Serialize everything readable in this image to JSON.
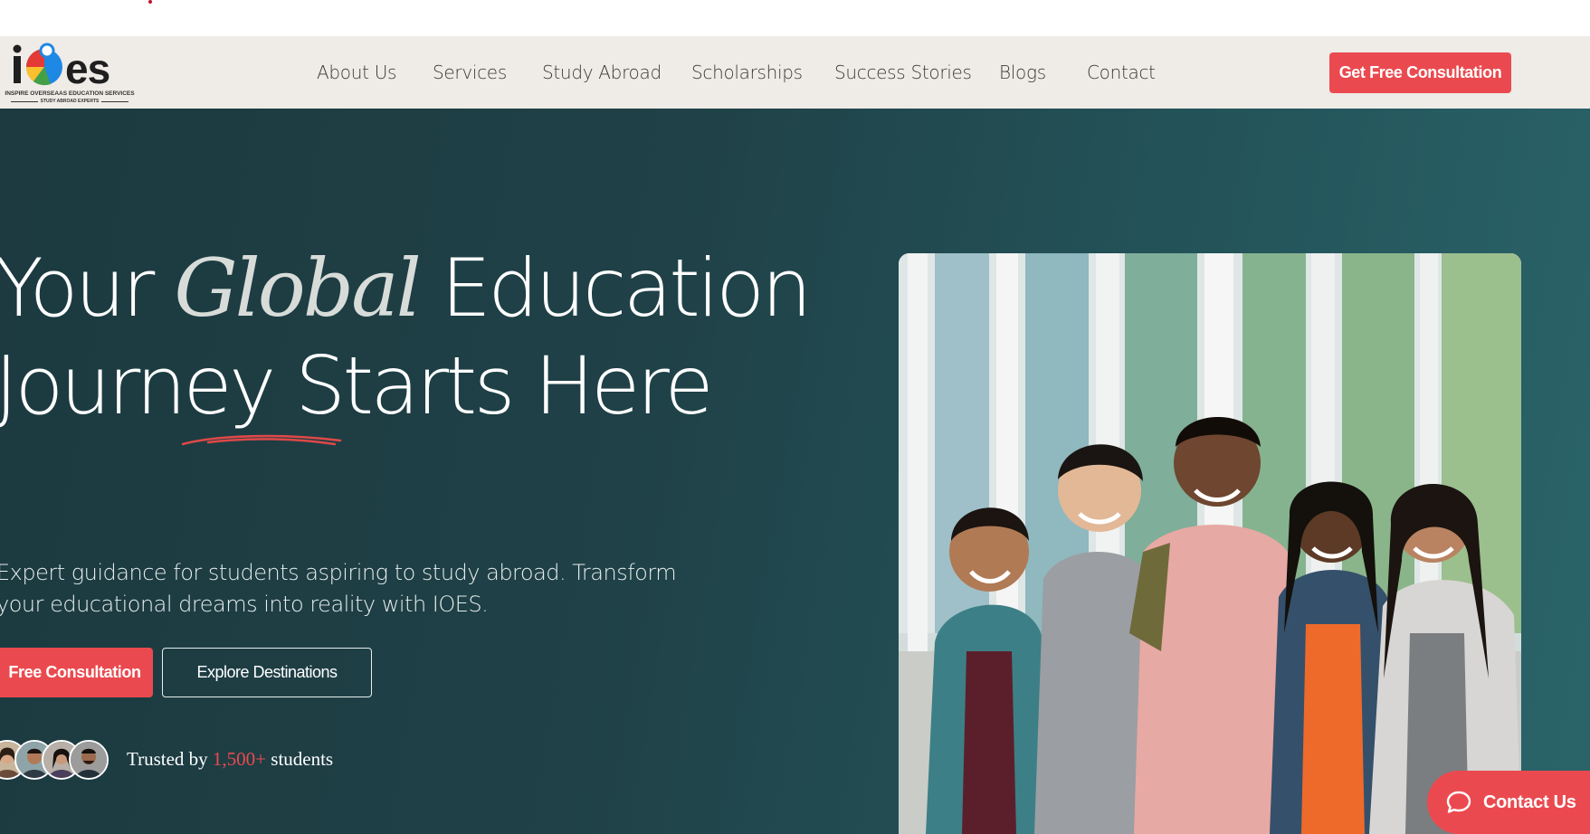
{
  "brand": {
    "logo_text": "ioes",
    "tagline": "INSPIRE OVERSEAAS EDUCATION SERVICES",
    "sub_tagline": "STUDY ABROAD EXPERTS"
  },
  "nav": {
    "items": [
      {
        "label": "About Us"
      },
      {
        "label": "Services"
      },
      {
        "label": "Study Abroad"
      },
      {
        "label": "Scholarships"
      },
      {
        "label": "Success Stories"
      },
      {
        "label": "Blogs"
      },
      {
        "label": "Contact"
      }
    ],
    "cta_label": "Get Free Consultation"
  },
  "hero": {
    "headline_part1": "Your",
    "headline_highlight": "Global",
    "headline_part2": "Education",
    "headline_line2": "Journey Starts Here",
    "subtext": "Expert guidance for students aspiring to study abroad. Transform your educational dreams into reality with IOES.",
    "primary_button": "Free Consultation",
    "secondary_button": "Explore Destinations",
    "trusted_prefix": "Trusted by",
    "trusted_count": "1,500+",
    "trusted_suffix": "students"
  },
  "chat_widget": {
    "label": "Contact Us"
  },
  "colors": {
    "accent": "#ea4a4f",
    "nav_bg": "#efebe7",
    "hero_bg_dark": "#1c3a40",
    "hero_bg_light": "#2a6469"
  }
}
